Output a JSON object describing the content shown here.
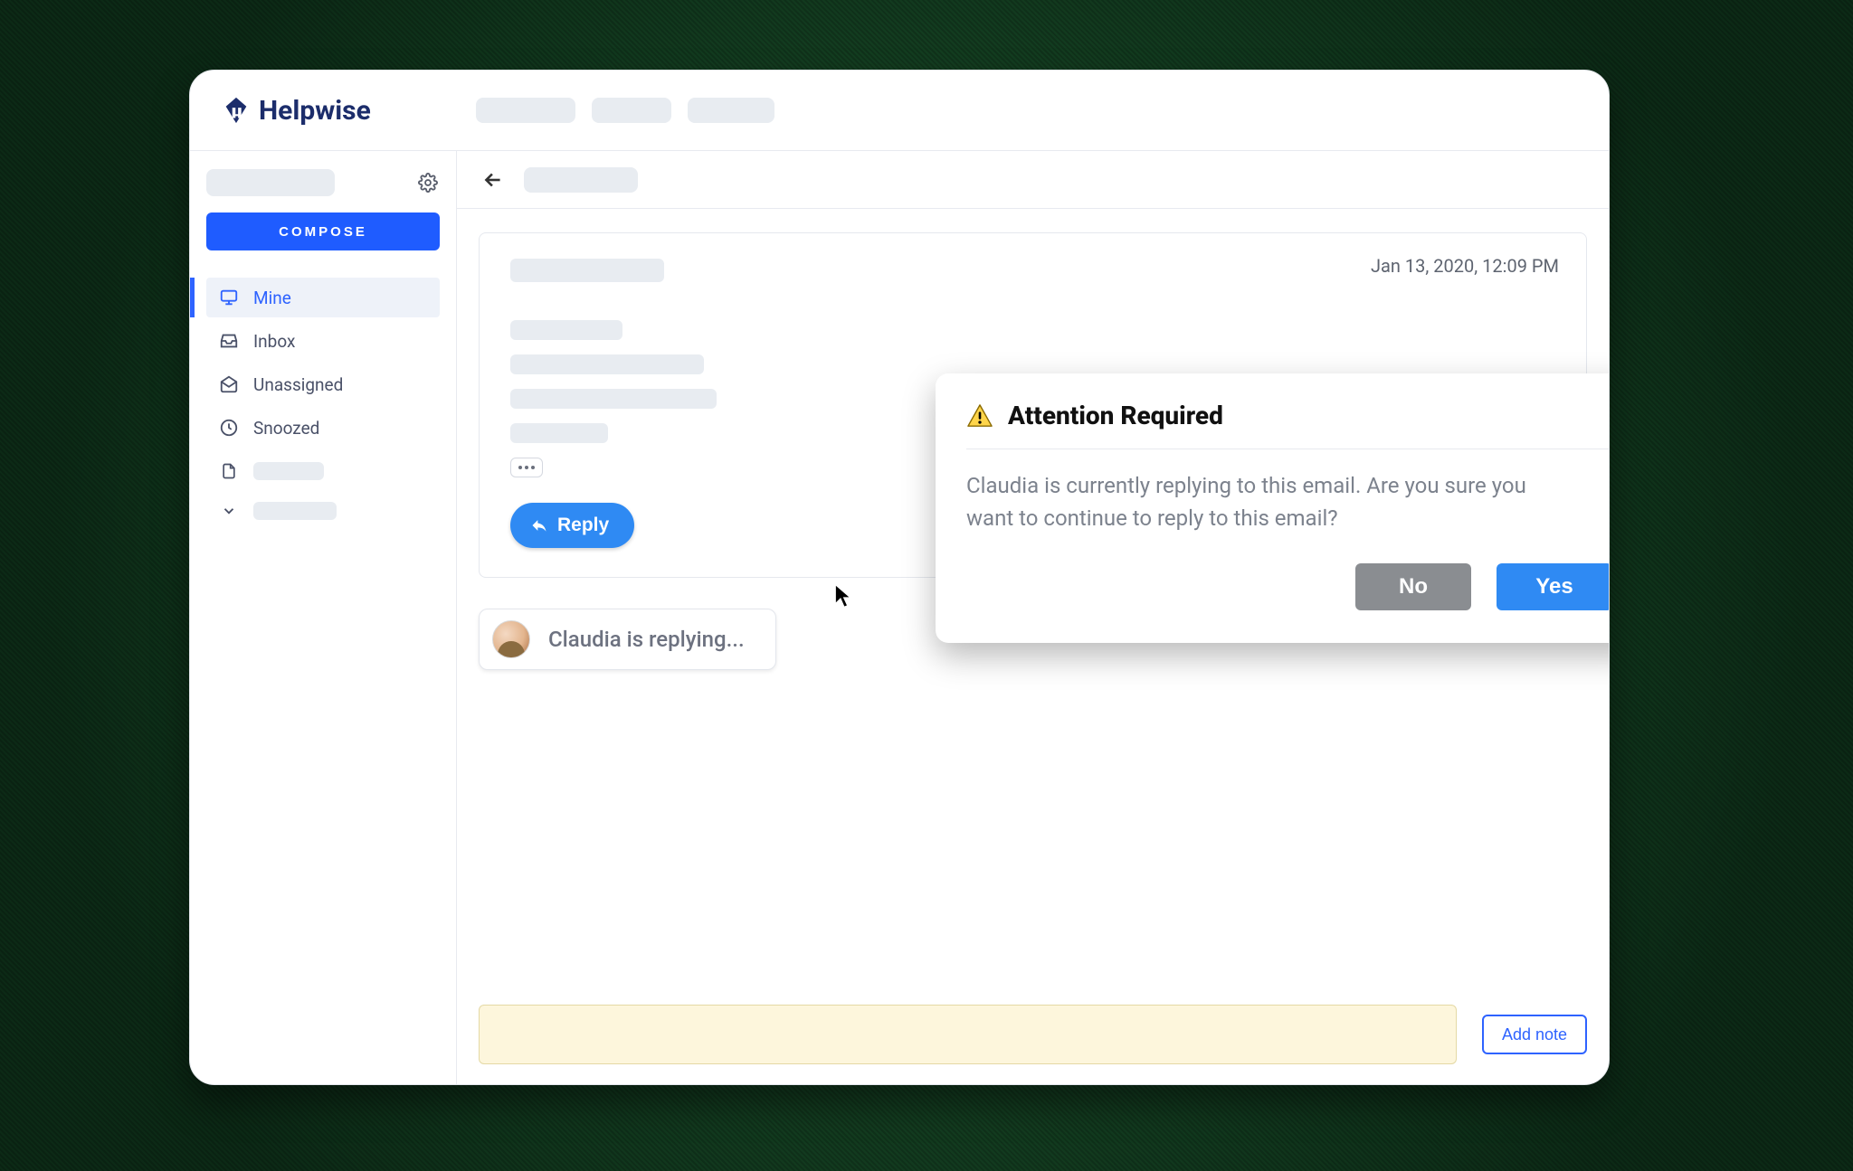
{
  "brand": {
    "name": "Helpwise"
  },
  "sidebar": {
    "compose_label": "COMPOSE",
    "items": [
      {
        "label": "Mine",
        "icon": "monitor"
      },
      {
        "label": "Inbox",
        "icon": "inbox"
      },
      {
        "label": "Unassigned",
        "icon": "mail-open"
      },
      {
        "label": "Snoozed",
        "icon": "clock"
      }
    ]
  },
  "email": {
    "date": "Jan 13, 2020, 12:09 PM",
    "reply_label": "Reply"
  },
  "typing": {
    "text": "Claudia is replying..."
  },
  "dialog": {
    "title": "Attention Required",
    "body": "Claudia is currently replying to this email. Are you sure you want to continue to reply to this email?",
    "no_label": "No",
    "yes_label": "Yes"
  },
  "notes": {
    "add_note_label": "Add note"
  }
}
